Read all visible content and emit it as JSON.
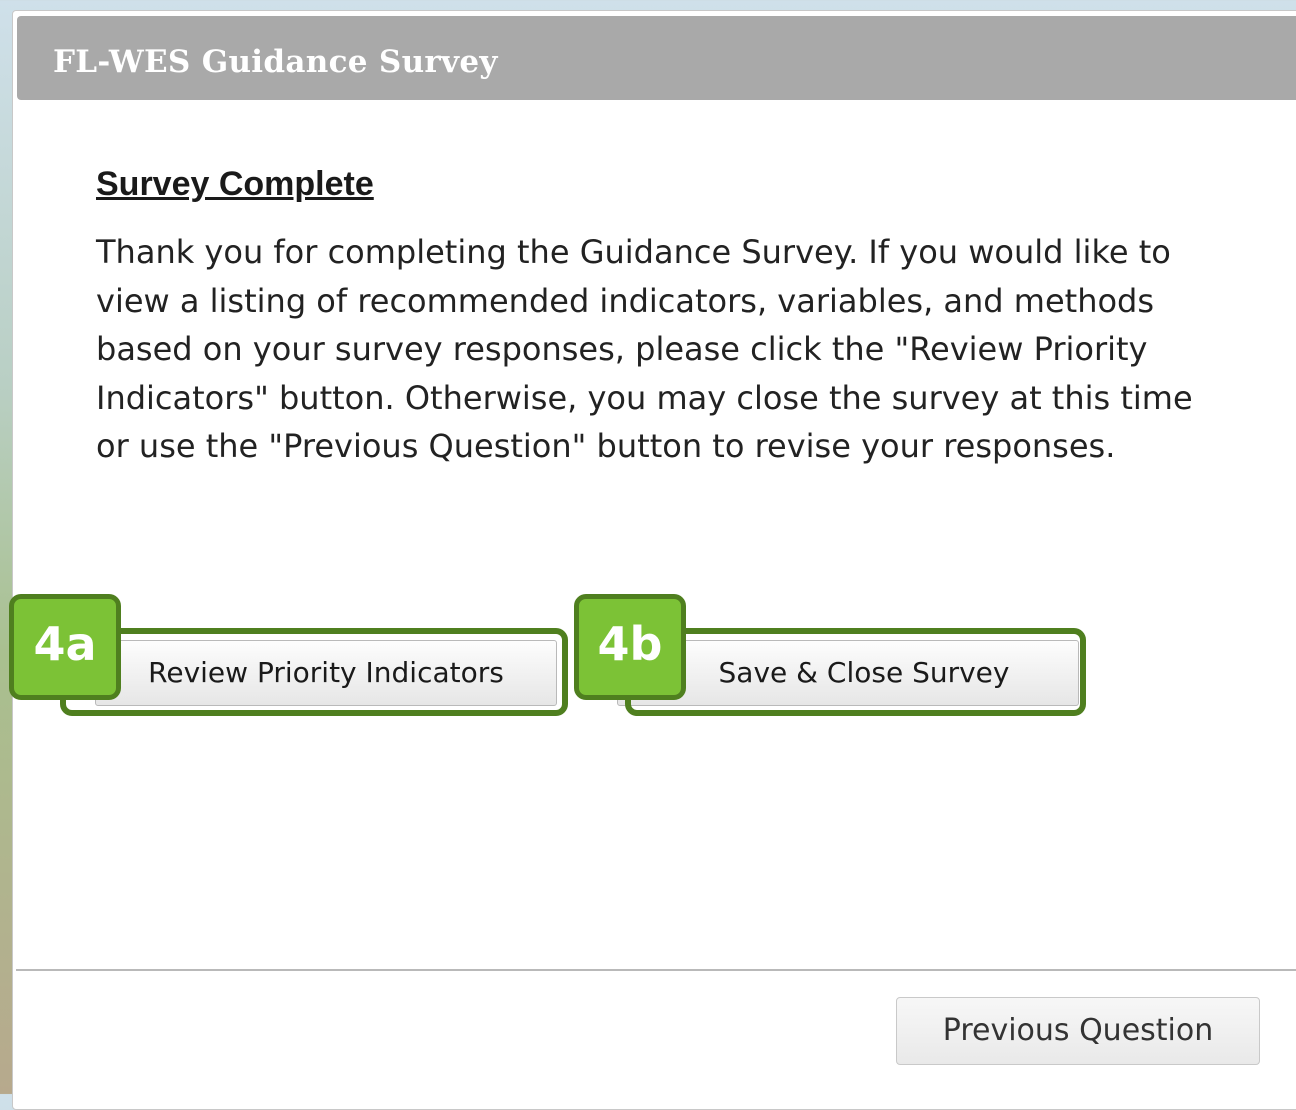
{
  "dialog": {
    "title": "FL-WES Guidance Survey"
  },
  "content": {
    "heading": "Survey Complete",
    "body": "Thank you for completing the Guidance Survey. If you would like to view a listing of recommended indicators, variables, and methods based on your survey responses, please click the \"Review Priority Indicators\" button. Otherwise, you may close the survey at this time or use the \"Previous Question\" button to revise your responses."
  },
  "buttons": {
    "review_label": "Review Priority Indicators",
    "save_close_label": "Save & Close Survey",
    "previous_label": "Previous Question"
  },
  "annotations": {
    "badge_a": "4a",
    "badge_b": "4b",
    "highlight_color": "#4f7f1f",
    "badge_fill_color": "#7cc236"
  }
}
